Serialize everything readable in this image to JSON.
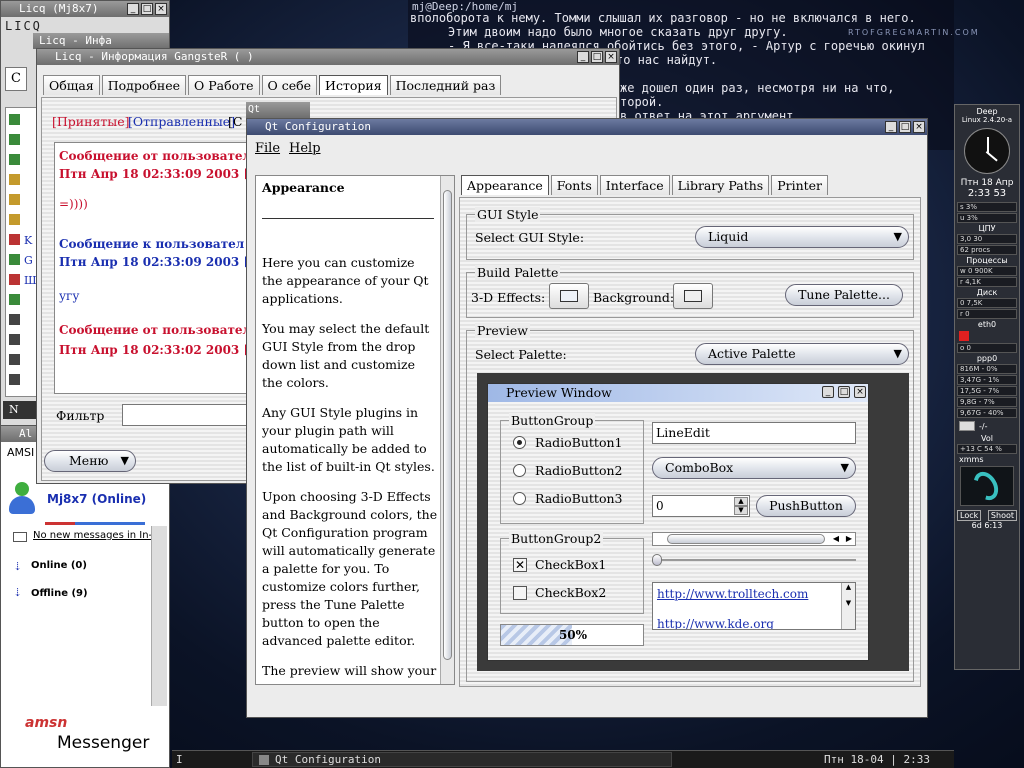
{
  "terminal": {
    "title": "mj@Deep:/home/mj",
    "lines": [
      "вполоборота к нему. Томми слышал их разговор - но не включался в него.",
      "Этим двоим надо было многое сказать друг другу.",
      "- Я все-таки надеялся обойтись без этого, - Артур с горечью окинул",
      "то нас найдут.",
      "же дошел один раз, несмотря ни на что,",
      "торой.",
      "в ответ на этот аргумент"
    ],
    "watermark": "RTOFGREGMARTIN.COM"
  },
  "licq": {
    "title": "Licq (Mj8x7)",
    "info_title": "Licq - Инфа",
    "logo": "LICQ",
    "button_label": "С",
    "letters": [
      "K",
      "G",
      "Ш"
    ],
    "bottom_label": "N",
    "aim_title": "Al"
  },
  "info_window": {
    "title": "Licq - Информация GangsteR ( )",
    "tabs": [
      "Общая",
      "Подробнее",
      "О Работе",
      "О себе",
      "История",
      "Последний раз"
    ],
    "selected_tab": "История",
    "filter_received": "[Принятые]",
    "filter_sent": "[Отправленные]",
    "filter_c": "[С",
    "messages": [
      {
        "header": "Сообщение от пользовател",
        "date": "Птн Апр 18 02:33:09 2003 [D-",
        "body": "=)))) ",
        "color": "#c8102e"
      },
      {
        "header": "Сообщение к пользовател",
        "date": "Птн Апр 18 02:33:09 2003 [---",
        "body": "угу",
        "color": "#1a2fb0"
      },
      {
        "header": "Сообщение от пользовател",
        "date": "Птн Апр 18 02:33:02 2003 [D-",
        "body": "",
        "color": "#c8102e"
      }
    ],
    "filter_label": "Фильтр",
    "menu_button": "Меню"
  },
  "amsn": {
    "top_label": "AMSI",
    "user_name": "Mj8x7 (Online)",
    "no_messages": "No new messages in In-",
    "online_group": "Online (0)",
    "offline_group": "Offline (9)",
    "banner_brand": "amsn",
    "banner_text": "Messenger"
  },
  "qtconfig": {
    "small_title": "Qt Configur",
    "title": "Qt Configuration",
    "menu": [
      "File",
      "Help"
    ],
    "help_title": "Appearance",
    "help_paragraphs": [
      "Here you can customize the appearance of your Qt applications.",
      "You may select the default GUI Style from the drop down list and customize the colors.",
      "Any GUI Style plugins in your plugin path will automatically be added to the list of built-in Qt styles.",
      "Upon choosing 3-D Effects and Background colors, the Qt Configuration program will automatically generate a palette for you. To customize colors further, press the Tune Palette button to open the advanced palette editor.",
      "The preview will show your"
    ],
    "tabs": [
      "Appearance",
      "Fonts",
      "Interface",
      "Library Paths",
      "Printer"
    ],
    "selected_tab": "Appearance",
    "gui_style_group": "GUI Style",
    "select_gui_style_label": "Select GUI Style:",
    "gui_style_value": "Liquid",
    "build_palette_group": "Build Palette",
    "effects_label": "3-D Effects:",
    "background_label": "Background:",
    "tune_palette_button": "Tune Palette...",
    "preview_group": "Preview",
    "select_palette_label": "Select Palette:",
    "palette_value": "Active Palette"
  },
  "preview": {
    "title": "Preview Window",
    "button_group": "ButtonGroup",
    "radios": [
      "RadioButton1",
      "RadioButton2",
      "RadioButton3"
    ],
    "button_group2": "ButtonGroup2",
    "checkboxes": [
      "CheckBox1",
      "CheckBox2"
    ],
    "line_edit": "LineEdit",
    "combo": "ComboBox",
    "spin_value": "0",
    "push_button": "PushButton",
    "progress_label": "50%",
    "progress_value": 50,
    "links": [
      "http://www.trolltech.com",
      "http://www.kde.org"
    ]
  },
  "monitor": {
    "host": "Deep",
    "kernel": "Linux 2.4.20-a",
    "date": "Птн 18 Апр",
    "time": "2:33 53",
    "cpu_label": "ЦПУ",
    "cpu_top": "s 3%",
    "cpu_bottom": "u 3%",
    "proc_top": "3,0 30",
    "proc_count": "62 procs",
    "proc_label": "Процессы",
    "disk_top": "w 0 900K",
    "disk_mid": "r 4,1K",
    "disk_label": "Диск",
    "net_top": "0 7,5K",
    "net_mid": "r 0",
    "eth": "eth0",
    "ppp": "o 0",
    "ppp_label": "ppp0",
    "mem": [
      "816M - 0%",
      "3,47G - 1%",
      "17,5G - 7%",
      "9,8G - 7%",
      "9,67G - 40%"
    ],
    "mail": "-/-",
    "vol": "Vol",
    "temp": "+13 C   54 %",
    "xmms": "xmms",
    "lock": "Lock",
    "shoot": "Shoot",
    "uptime": "6d 6:13"
  },
  "taskbar": {
    "left_item": "I",
    "task": "Qt Configuration",
    "clock": "Птн 18-04 | 2:33"
  }
}
